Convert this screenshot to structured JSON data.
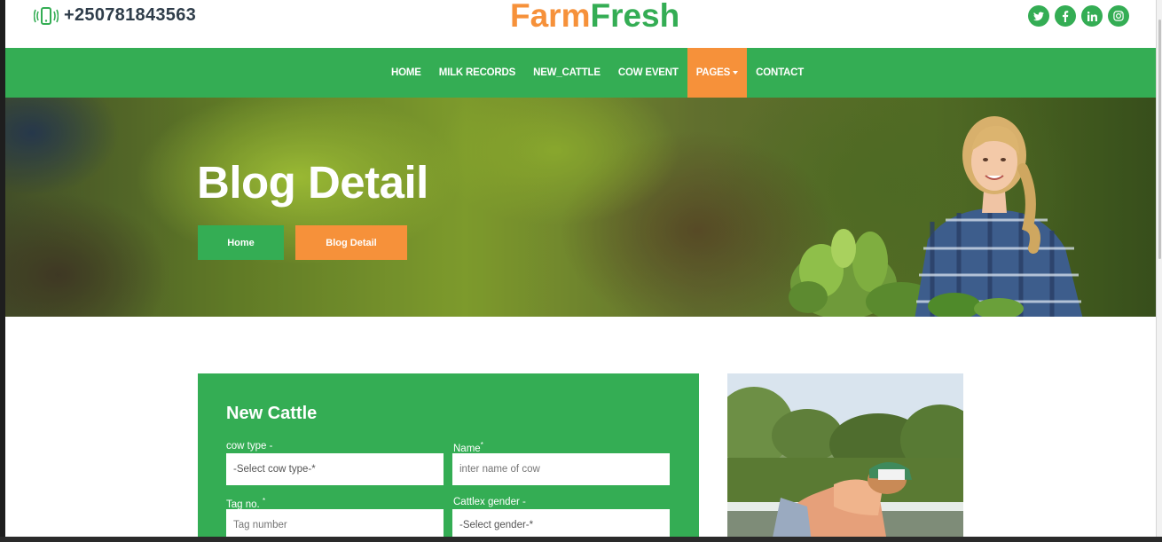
{
  "header": {
    "phone": "+250781843563",
    "phone_icon": "mobile-vibrate-icon",
    "logo_part1": "Farm",
    "logo_part2": "Fresh",
    "social": [
      "twitter-icon",
      "facebook-icon",
      "linkedin-icon",
      "instagram-icon"
    ]
  },
  "nav": {
    "items": [
      "HOME",
      "MILK RECORDS",
      "NEW_CATTLE",
      "COW EVENT",
      "PAGES",
      "CONTACT"
    ],
    "active": "PAGES"
  },
  "hero": {
    "title": "Blog Detail",
    "breadcrumb_home": "Home",
    "breadcrumb_current": "Blog Detail"
  },
  "form": {
    "title": "New Cattle",
    "cow_type_label": "cow type -",
    "cow_type_value": "-Select cow type-*",
    "name_label": "Name",
    "name_required": "*",
    "name_placeholder": "inter name of cow",
    "tag_label": "Tag no.",
    "tag_required": "*",
    "tag_placeholder": "Tag number",
    "gender_label": "Cattlex gender -",
    "gender_value": "-Select gender-*"
  },
  "colors": {
    "green": "#34ad54",
    "orange": "#f6913a",
    "dark_text": "#2f3d4a"
  }
}
